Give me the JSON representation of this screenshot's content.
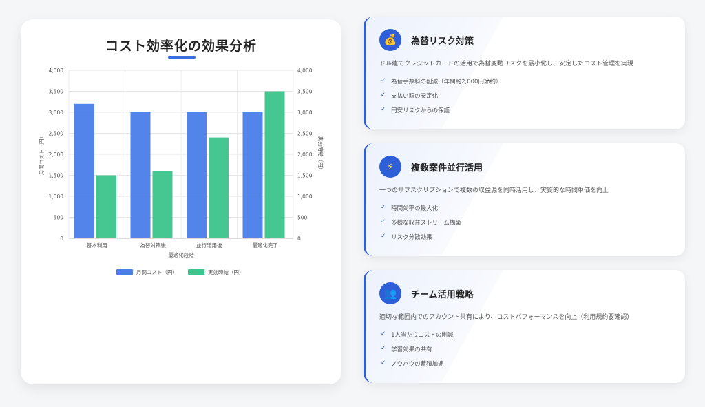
{
  "chart_data": {
    "type": "bar",
    "title": "コスト効率化の効果分析",
    "categories": [
      "基本利用",
      "為替対策後",
      "並行活用後",
      "最適化完了"
    ],
    "xlabel": "最適化段階",
    "ylabel_left": "月間コスト（円）",
    "ylabel_right": "実効時給（円）",
    "ylim": [
      0,
      4000
    ],
    "yticks": [
      "0",
      "500",
      "1,000",
      "1,500",
      "2,000",
      "2,500",
      "3,000",
      "3,500",
      "4,000"
    ],
    "grid": true,
    "legend_position": "bottom",
    "series": [
      {
        "name": "月間コスト（円）",
        "values": [
          3200,
          3000,
          3000,
          3000
        ],
        "color": "#4a7de8"
      },
      {
        "name": "実効時給（円）",
        "values": [
          1500,
          1600,
          2400,
          3500
        ],
        "color": "#3cc48c"
      }
    ]
  },
  "cards": [
    {
      "icon": "money-bag-icon",
      "icon_glyph": "💰",
      "title": "為替リスク対策",
      "description": "ドル建てクレジットカードの活用で為替変動リスクを最小化し、安定したコスト管理を実現",
      "items": [
        "為替手数料の削減（年間約2,000円節約）",
        "支払い額の安定化",
        "円安リスクからの保護"
      ]
    },
    {
      "icon": "lightning-icon",
      "icon_glyph": "⚡",
      "title": "複数案件並行活用",
      "description": "一つのサブスクリプションで複数の収益源を同時活用し、実質的な時間単価を向上",
      "items": [
        "時間効率の最大化",
        "多様な収益ストリーム構築",
        "リスク分散効果"
      ]
    },
    {
      "icon": "team-icon",
      "icon_glyph": "👥",
      "title": "チーム活用戦略",
      "description": "適切な範囲内でのアカウント共有により、コストパフォーマンスを向上（利用規約要確認）",
      "items": [
        "1人当たりコストの削減",
        "学習効果の共有",
        "ノウハウの蓄積加速"
      ]
    }
  ],
  "check_glyph": "✓"
}
